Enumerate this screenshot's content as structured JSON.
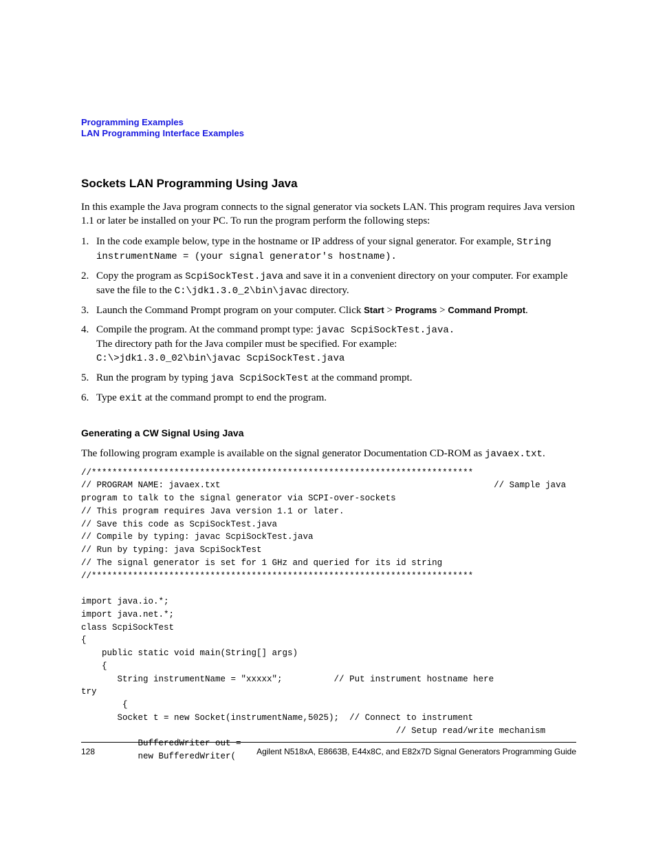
{
  "header": {
    "line1": "Programming Examples",
    "line2": "LAN Programming Interface Examples"
  },
  "section_title": "Sockets LAN Programming Using Java",
  "intro": "In this example the Java program connects to the signal generator via sockets LAN. This program requires Java version 1.1 or later be installed on your PC. To run the program perform the following steps:",
  "steps": [
    {
      "num": "1.",
      "pre": "In the code example below, type in the hostname or IP address of your signal generator. For example, ",
      "code": "String instrumentName = (your signal generator's hostname).",
      "post": ""
    },
    {
      "num": "2.",
      "pre": "Copy the program as ",
      "code1": "ScpiSockTest.java",
      "mid": " and save it in a convenient directory on your computer. For example save the file to the ",
      "code2": "C:\\jdk1.3.0_2\\bin\\javac",
      "post": " directory."
    },
    {
      "num": "3.",
      "pre": "Launch the Command Prompt program on your computer. Click ",
      "b1": "Start",
      "sep1": " > ",
      "b2": "Programs",
      "sep2": " > ",
      "b3": "Command Prompt",
      "post": "."
    },
    {
      "num": "4.",
      "pre": "Compile the program. At the command prompt type: ",
      "code1": "javac ScpiSockTest.java.",
      "line2": "The directory path for the Java compiler must be specified. For example:",
      "code2": "C:\\>jdk1.3.0_02\\bin\\javac ScpiSockTest.java"
    },
    {
      "num": "5.",
      "pre": "Run the program by typing ",
      "code1": "java ScpiSockTest",
      "post": " at the command prompt."
    },
    {
      "num": "6.",
      "pre": "Type ",
      "code1": "exit",
      "post": " at the command prompt to end the program."
    }
  ],
  "subhead": "Generating a CW Signal Using Java",
  "avail_pre": "The following program example is available on the signal generator Documentation CD-ROM as ",
  "avail_code": "javaex.txt",
  "avail_post": ".",
  "code": "//**************************************************************************\n// PROGRAM NAME: javaex.txt                                                     // Sample java \nprogram to talk to the signal generator via SCPI-over-sockets\n// This program requires Java version 1.1 or later.\n// Save this code as ScpiSockTest.java\n// Compile by typing: javac ScpiSockTest.java\n// Run by typing: java ScpiSockTest\n// The signal generator is set for 1 GHz and queried for its id string\n//**************************************************************************\n\nimport java.io.*;\nimport java.net.*;\nclass ScpiSockTest\n{\n    public static void main(String[] args)\n    {\n       String instrumentName = \"xxxxx\";          // Put instrument hostname here \ntry \n        {\n       Socket t = new Socket(instrumentName,5025);  // Connect to instrument\n                                                             // Setup read/write mechanism\n           BufferedWriter out =\n           new BufferedWriter(",
  "footer": {
    "page": "128",
    "title": "Agilent N518xA, E8663B, E44x8C, and E82x7D Signal Generators Programming Guide"
  }
}
